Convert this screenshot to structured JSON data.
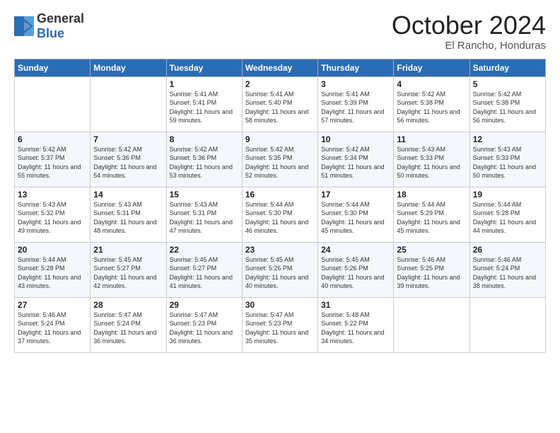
{
  "logo": {
    "general": "General",
    "blue": "Blue"
  },
  "header": {
    "month": "October 2024",
    "location": "El Rancho, Honduras"
  },
  "columns": [
    "Sunday",
    "Monday",
    "Tuesday",
    "Wednesday",
    "Thursday",
    "Friday",
    "Saturday"
  ],
  "weeks": [
    [
      {
        "day": "",
        "info": ""
      },
      {
        "day": "",
        "info": ""
      },
      {
        "day": "1",
        "info": "Sunrise: 5:41 AM\nSunset: 5:41 PM\nDaylight: 11 hours and 59 minutes."
      },
      {
        "day": "2",
        "info": "Sunrise: 5:41 AM\nSunset: 5:40 PM\nDaylight: 11 hours and 58 minutes."
      },
      {
        "day": "3",
        "info": "Sunrise: 5:41 AM\nSunset: 5:39 PM\nDaylight: 11 hours and 57 minutes."
      },
      {
        "day": "4",
        "info": "Sunrise: 5:42 AM\nSunset: 5:38 PM\nDaylight: 11 hours and 56 minutes."
      },
      {
        "day": "5",
        "info": "Sunrise: 5:42 AM\nSunset: 5:38 PM\nDaylight: 11 hours and 56 minutes."
      }
    ],
    [
      {
        "day": "6",
        "info": "Sunrise: 5:42 AM\nSunset: 5:37 PM\nDaylight: 11 hours and 55 minutes."
      },
      {
        "day": "7",
        "info": "Sunrise: 5:42 AM\nSunset: 5:36 PM\nDaylight: 11 hours and 54 minutes."
      },
      {
        "day": "8",
        "info": "Sunrise: 5:42 AM\nSunset: 5:36 PM\nDaylight: 11 hours and 53 minutes."
      },
      {
        "day": "9",
        "info": "Sunrise: 5:42 AM\nSunset: 5:35 PM\nDaylight: 11 hours and 52 minutes."
      },
      {
        "day": "10",
        "info": "Sunrise: 5:42 AM\nSunset: 5:34 PM\nDaylight: 11 hours and 51 minutes."
      },
      {
        "day": "11",
        "info": "Sunrise: 5:43 AM\nSunset: 5:33 PM\nDaylight: 11 hours and 50 minutes."
      },
      {
        "day": "12",
        "info": "Sunrise: 5:43 AM\nSunset: 5:33 PM\nDaylight: 11 hours and 50 minutes."
      }
    ],
    [
      {
        "day": "13",
        "info": "Sunrise: 5:43 AM\nSunset: 5:32 PM\nDaylight: 11 hours and 49 minutes."
      },
      {
        "day": "14",
        "info": "Sunrise: 5:43 AM\nSunset: 5:31 PM\nDaylight: 11 hours and 48 minutes."
      },
      {
        "day": "15",
        "info": "Sunrise: 5:43 AM\nSunset: 5:31 PM\nDaylight: 11 hours and 47 minutes."
      },
      {
        "day": "16",
        "info": "Sunrise: 5:44 AM\nSunset: 5:30 PM\nDaylight: 11 hours and 46 minutes."
      },
      {
        "day": "17",
        "info": "Sunrise: 5:44 AM\nSunset: 5:30 PM\nDaylight: 11 hours and 45 minutes."
      },
      {
        "day": "18",
        "info": "Sunrise: 5:44 AM\nSunset: 5:29 PM\nDaylight: 11 hours and 45 minutes."
      },
      {
        "day": "19",
        "info": "Sunrise: 5:44 AM\nSunset: 5:28 PM\nDaylight: 11 hours and 44 minutes."
      }
    ],
    [
      {
        "day": "20",
        "info": "Sunrise: 5:44 AM\nSunset: 5:28 PM\nDaylight: 11 hours and 43 minutes."
      },
      {
        "day": "21",
        "info": "Sunrise: 5:45 AM\nSunset: 5:27 PM\nDaylight: 11 hours and 42 minutes."
      },
      {
        "day": "22",
        "info": "Sunrise: 5:45 AM\nSunset: 5:27 PM\nDaylight: 11 hours and 41 minutes."
      },
      {
        "day": "23",
        "info": "Sunrise: 5:45 AM\nSunset: 5:26 PM\nDaylight: 11 hours and 40 minutes."
      },
      {
        "day": "24",
        "info": "Sunrise: 5:45 AM\nSunset: 5:26 PM\nDaylight: 11 hours and 40 minutes."
      },
      {
        "day": "25",
        "info": "Sunrise: 5:46 AM\nSunset: 5:25 PM\nDaylight: 11 hours and 39 minutes."
      },
      {
        "day": "26",
        "info": "Sunrise: 5:46 AM\nSunset: 5:24 PM\nDaylight: 11 hours and 38 minutes."
      }
    ],
    [
      {
        "day": "27",
        "info": "Sunrise: 5:46 AM\nSunset: 5:24 PM\nDaylight: 11 hours and 37 minutes."
      },
      {
        "day": "28",
        "info": "Sunrise: 5:47 AM\nSunset: 5:24 PM\nDaylight: 11 hours and 36 minutes."
      },
      {
        "day": "29",
        "info": "Sunrise: 5:47 AM\nSunset: 5:23 PM\nDaylight: 11 hours and 36 minutes."
      },
      {
        "day": "30",
        "info": "Sunrise: 5:47 AM\nSunset: 5:23 PM\nDaylight: 11 hours and 35 minutes."
      },
      {
        "day": "31",
        "info": "Sunrise: 5:48 AM\nSunset: 5:22 PM\nDaylight: 11 hours and 34 minutes."
      },
      {
        "day": "",
        "info": ""
      },
      {
        "day": "",
        "info": ""
      }
    ]
  ]
}
